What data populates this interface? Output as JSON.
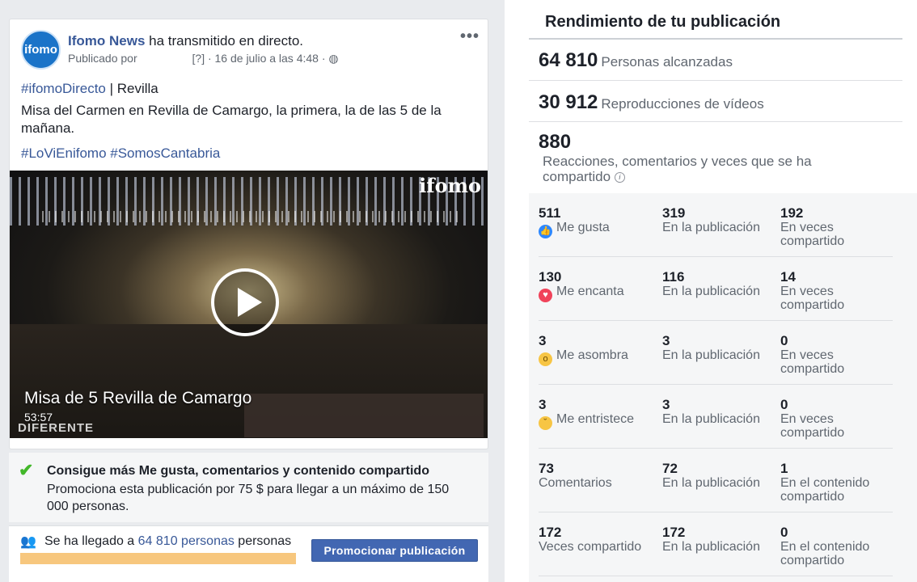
{
  "post": {
    "avatar_text": "ifomo",
    "page_name": "Ifomo News",
    "action": " ha transmitido en directo.",
    "published_by": "Publicado por",
    "meta_tail": "[?] · 16 de julio a las 4:48 ·",
    "globe_icon": "globe-icon",
    "more": "•••",
    "line1_tag": "#ifomoDirecto",
    "line1_rest": " | Revilla",
    "body": "Misa del Carmen en Revilla de Camargo, la primera, la de las 5 de la mañana.",
    "tags": "#LoViEnifomo #SomosCantabria"
  },
  "video": {
    "logo": "ifomo",
    "title": "Misa de 5 Revilla de Camargo",
    "duration": "53:57",
    "brand": "DIFERENTE"
  },
  "promo": {
    "title": "Consigue más Me gusta, comentarios y contenido compartido",
    "desc": "Promociona esta publicación por 75 $ para llegar a un máximo de 150 000 personas."
  },
  "reach": {
    "prefix": "Se ha llegado a ",
    "count": "64 810 personas",
    "suffix": " personas",
    "button": "Promocionar publicación"
  },
  "performance": {
    "title": "Rendimiento de tu publicación",
    "reached_value": "64 810",
    "reached_label": "Personas alcanzadas",
    "views_value": "30 912",
    "views_label": "Reproducciones de vídeos",
    "engagement_value": "880",
    "engagement_label": "Reacciones, comentarios y veces que se ha compartido",
    "info_icon": "i",
    "rows": [
      {
        "total": "511",
        "label": "Me gusta",
        "post": "319",
        "post_label": "En la publicación",
        "shared": "192",
        "shared_label": "En veces compartido"
      },
      {
        "total": "130",
        "label": "Me encanta",
        "post": "116",
        "post_label": "En la publicación",
        "shared": "14",
        "shared_label": "En veces compartido"
      },
      {
        "total": "3",
        "label": "Me asombra",
        "post": "3",
        "post_label": "En la publicación",
        "shared": "0",
        "shared_label": "En veces compartido"
      },
      {
        "total": "3",
        "label": "Me entristece",
        "post": "3",
        "post_label": "En la publicación",
        "shared": "0",
        "shared_label": "En veces compartido"
      },
      {
        "total": "73",
        "label": "Comentarios",
        "post": "72",
        "post_label": "En la publicación",
        "shared": "1",
        "shared_label": "En el contenido compartido"
      },
      {
        "total": "172",
        "label": "Veces compartido",
        "post": "172",
        "post_label": "En la publicación",
        "shared": "0",
        "shared_label": "En el contenido compartido"
      }
    ]
  }
}
